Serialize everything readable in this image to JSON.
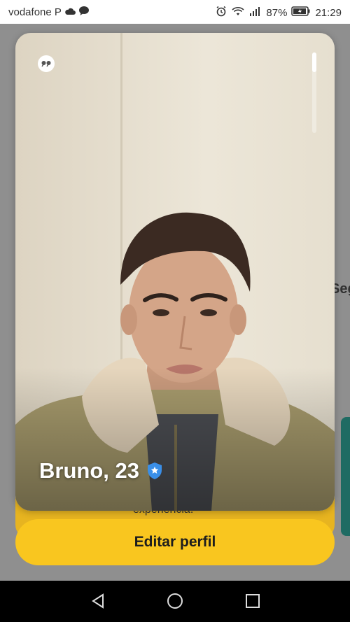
{
  "status_bar": {
    "carrier": "vodafone P",
    "battery": "87%",
    "time": "21:29"
  },
  "background": {
    "peek_text": "Seg",
    "peek_caption": "experiência."
  },
  "profile": {
    "name_age": "Bruno, 23",
    "verified_icon": "verified-shield-star-icon",
    "quote_icon": "quote-icon"
  },
  "actions": {
    "edit_label": "Editar perfil"
  },
  "colors": {
    "accent": "#f9c61f",
    "verified": "#3a8fe8"
  }
}
